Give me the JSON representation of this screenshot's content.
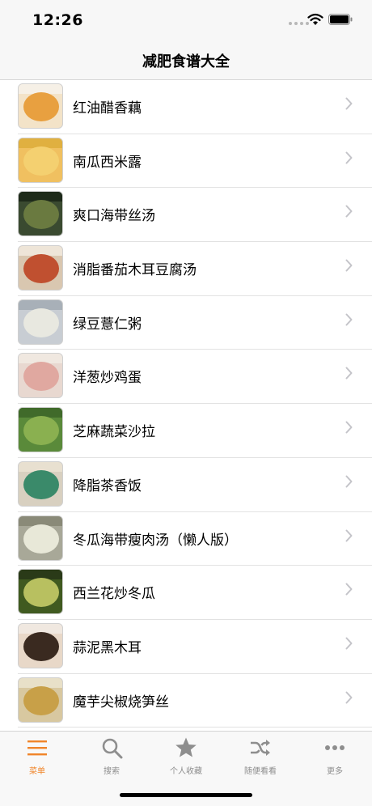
{
  "status_bar": {
    "time": "12:26"
  },
  "nav": {
    "title": "减肥食谱大全"
  },
  "recipes": [
    {
      "name": "红油醋香藕",
      "thumb_bg": "#f3e3c8",
      "thumb_plate": "#e8a040",
      "thumb_top": "#f6f0e6"
    },
    {
      "name": "南瓜西米露",
      "thumb_bg": "#f0c060",
      "thumb_plate": "#f4d070",
      "thumb_top": "#e0b040"
    },
    {
      "name": "爽口海带丝汤",
      "thumb_bg": "#3a4a30",
      "thumb_plate": "#6a7a40",
      "thumb_top": "#1e2a1a"
    },
    {
      "name": "消脂番茄木耳豆腐汤",
      "thumb_bg": "#d9c7b0",
      "thumb_plate": "#c05030",
      "thumb_top": "#eee5d8"
    },
    {
      "name": "绿豆薏仁粥",
      "thumb_bg": "#c8cdd3",
      "thumb_plate": "#e8e8e0",
      "thumb_top": "#a8b0b8"
    },
    {
      "name": "洋葱炒鸡蛋",
      "thumb_bg": "#e8d8d0",
      "thumb_plate": "#e0a8a0",
      "thumb_top": "#f0e8e0"
    },
    {
      "name": "芝麻蔬菜沙拉",
      "thumb_bg": "#5a8a3a",
      "thumb_plate": "#8ab050",
      "thumb_top": "#406a2a"
    },
    {
      "name": "降脂茶香饭",
      "thumb_bg": "#d8d0c0",
      "thumb_plate": "#3a8a6a",
      "thumb_top": "#e8e0d0"
    },
    {
      "name": "冬瓜海带瘦肉汤（懒人版）",
      "thumb_bg": "#a8a898",
      "thumb_plate": "#e8e8d8",
      "thumb_top": "#8a8a78"
    },
    {
      "name": "西兰花炒冬瓜",
      "thumb_bg": "#405a20",
      "thumb_plate": "#b8c060",
      "thumb_top": "#2a3a18"
    },
    {
      "name": "蒜泥黑木耳",
      "thumb_bg": "#e8d8c8",
      "thumb_plate": "#3a2a20",
      "thumb_top": "#f0e8e0"
    },
    {
      "name": "魔芋尖椒烧笋丝",
      "thumb_bg": "#d8c8a0",
      "thumb_plate": "#c8a048",
      "thumb_top": "#e8e0c8"
    },
    {
      "name": "",
      "thumb_bg": "#c8b898",
      "thumb_plate": "#b09060",
      "thumb_top": "#d8c8a8"
    }
  ],
  "tabs": [
    {
      "label": "菜单",
      "icon": "menu-icon",
      "active": true
    },
    {
      "label": "搜索",
      "icon": "search-icon",
      "active": false
    },
    {
      "label": "个人收藏",
      "icon": "star-icon",
      "active": false
    },
    {
      "label": "随便看看",
      "icon": "shuffle-icon",
      "active": false
    },
    {
      "label": "更多",
      "icon": "more-icon",
      "active": false
    }
  ],
  "colors": {
    "accent": "#f0852a",
    "inactive": "#8e8e8e"
  }
}
